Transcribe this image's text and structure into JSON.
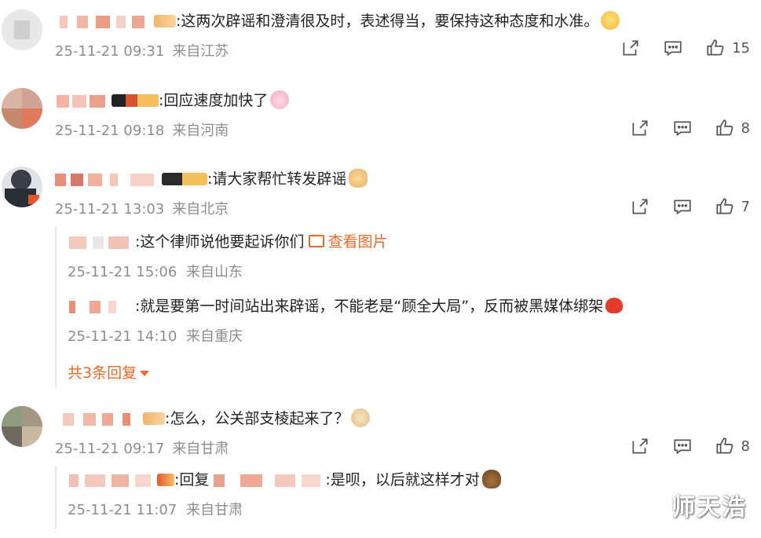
{
  "comments": [
    {
      "text": ":这两次辟谣和澄清很及时，表述得当，要保持这种态度和水准。",
      "time": "25-11-21 09:31",
      "location": "来自江苏",
      "likes": "15",
      "emoji": "blush-emoji"
    },
    {
      "text": ":回应速度加快了",
      "time": "25-11-21 09:18",
      "location": "来自河南",
      "likes": "8",
      "emoji": "bunny-emoji"
    },
    {
      "text": ":请大家帮忙转发辟谣",
      "time": "25-11-21 13:03",
      "location": "来自北京",
      "likes": "7",
      "emoji": "pray-emoji",
      "replies": [
        {
          "text": ":这个律师说他要起诉你们",
          "link": "查看图片",
          "time": "25-11-21 15:06",
          "location": "来自山东"
        },
        {
          "text": ":就是要第一时间站出来辟谣，不能老是“顾全大局”，反而被黑媒体绑架",
          "time": "25-11-21 14:10",
          "location": "来自重庆",
          "emoji": "heart-emoji"
        }
      ],
      "more_replies": "共3条回复"
    },
    {
      "text": ":怎么，公关部支棱起来了？",
      "time": "25-11-21 09:17",
      "location": "来自甘肃",
      "likes": "8",
      "emoji": "doge-emoji",
      "replies": [
        {
          "text_prefix": ":回复",
          "text": ":是呗，以后就这样才对",
          "time": "25-11-21 11:07",
          "location": "来自甘肃",
          "emoji": "poop-emoji"
        }
      ]
    }
  ],
  "watermark": "师天浩",
  "colors": {
    "accent": "#e96a28",
    "meta": "#8d8d8d",
    "text": "#222222"
  }
}
